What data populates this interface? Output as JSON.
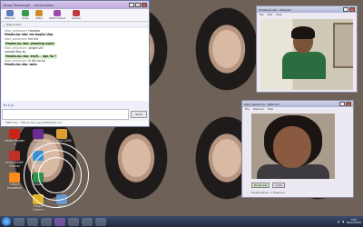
{
  "im_window": {
    "title": "Yahoo! Messenger - conversation",
    "toolbar": [
      "Webcam",
      "Voice",
      "Share",
      "IMVironment",
      "Games"
    ],
    "status_line": "• status text",
    "messages": [
      {
        "who": "febe_seliamore:",
        "text": "Hahaha",
        "style": "plain"
      },
      {
        "who": "",
        "text": "Hmata.ko.nko: me bogha Unp",
        "style": "bold"
      },
      {
        "who": "febe_seliamore:",
        "text": "hhi hhi",
        "style": "plain"
      },
      {
        "who": "",
        "text": "Hmata.ko.nko: planning ayain",
        "style": "hl"
      },
      {
        "who": "febe_seliamore:",
        "text": "yingeil zkl",
        "style": "plain"
      },
      {
        "who": "",
        "text": "sample Bay ko",
        "style": "plain"
      },
      {
        "who": "",
        "text": "Hmata.ko.nko: enyil... nga hu ?",
        "style": "hl"
      },
      {
        "who": "febe_seliamore:",
        "text": "hi din ko ha",
        "style": "plain"
      },
      {
        "who": "",
        "text": "Hmata.ko.nko: wala",
        "style": "plain"
      }
    ],
    "input_toolbar": "B  I  U  ☺",
    "send_label": "Send",
    "ad_text": "ESPN Star - Official Site   www.ESPNSTAR.com"
  },
  "cam_top": {
    "title": "hmata.ko.nko - Webcam",
    "menu": [
      "File",
      "Edit",
      "Help"
    ],
    "footer": ""
  },
  "cam_bottom": {
    "title": "febe_seliamore - Webcam",
    "menu": [
      "File",
      "Webcam",
      "Help"
    ],
    "button_primary": "Broadcast",
    "button_secondary": "Invite",
    "footer": "Broadcasting · 1 Viewer(s)"
  },
  "desktop_icons": [
    {
      "label": "Adobe Reader 9",
      "icon": "adobe-icon",
      "color": "#c8251b"
    },
    {
      "label": "Yahoo! Messenger",
      "icon": "yahoo-icon",
      "color": "#6b2c91"
    },
    {
      "label": "Alcohol 120%",
      "icon": "alcohol-icon",
      "color": "#d9a030"
    },
    {
      "label": "Avira AntiVir Control",
      "icon": "avira-icon",
      "color": "#c0302a"
    },
    {
      "label": "CCleaner",
      "icon": "ccleaner-icon",
      "color": "#3a8fd0"
    },
    {
      "label": "Cdcore BroadBeat",
      "icon": "cdcore-icon",
      "color": "#ff8c1a"
    },
    {
      "label": "Gallery",
      "icon": "gallery-icon",
      "color": "#2f8f4f"
    },
    {
      "label": "Google Chrome",
      "icon": "chrome-icon",
      "color": "#e4b22a"
    },
    {
      "label": "Nero",
      "icon": "nero-icon",
      "color": "#6699cc"
    }
  ],
  "taskbar": {
    "time": "3:05",
    "date": "06/12/2010",
    "apps": [
      "ie-icon",
      "explorer-icon",
      "media-icon",
      "yahoo-icon",
      "chrome-icon",
      "firefox-icon",
      "paint-icon"
    ]
  }
}
